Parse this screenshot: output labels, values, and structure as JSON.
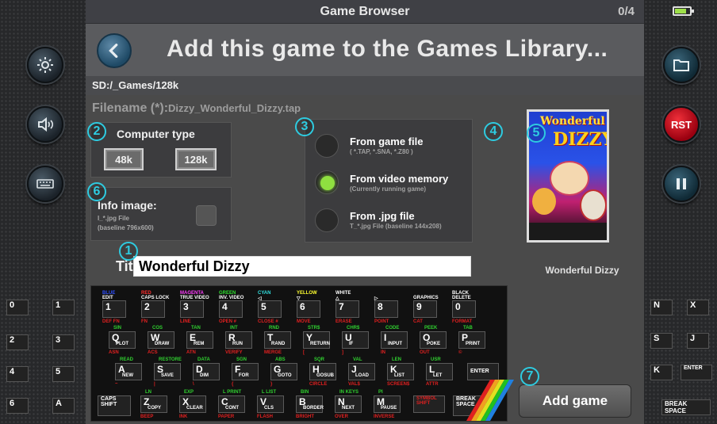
{
  "window": {
    "title": "Game Browser",
    "counter": "0/4"
  },
  "header": {
    "title": "Add this game to the Games Library..."
  },
  "path": "SD:/_Games/128k",
  "filename": {
    "label": "Filename (*):",
    "value": "Dizzy_Wonderful_Dizzy.tap"
  },
  "computer_type": {
    "label": "Computer type",
    "options": [
      "48k",
      "128k"
    ]
  },
  "info_image": {
    "label": "Info image:",
    "line1": "I_*.jpg File",
    "line2": "(baseline 796x600)"
  },
  "sources": [
    {
      "label": "From game file",
      "sub": "( *.TAP, *.SNA, *.Z80 )",
      "selected": false
    },
    {
      "label": "From video memory",
      "sub": "(Currently running game)",
      "selected": true
    },
    {
      "label": "From .jpg file",
      "sub": "T_*.jpg File (baseline 144x208)",
      "selected": false
    }
  ],
  "numbers": [
    "1",
    "2",
    "3",
    "4",
    "5",
    "6",
    "7"
  ],
  "title_field": {
    "label": "Title:",
    "value": "Wonderful Dizzy"
  },
  "cover": {
    "name": "Wonderful Dizzy",
    "art_text": "Wonderful",
    "art_text2": "DIZZY"
  },
  "add_button": "Add game",
  "keyboard": {
    "row1": [
      "1",
      "2",
      "3",
      "4",
      "5",
      "6",
      "7",
      "8",
      "9",
      "0"
    ],
    "row1_top": [
      "EDIT",
      "CAPS LOCK",
      "TRUE VIDEO",
      "INV. VIDEO",
      "◁",
      "▽",
      "△",
      "▷",
      "GRAPHICS",
      "DELETE"
    ],
    "row1_top_colors": [
      "BLUE",
      "RED",
      "MAGENTA",
      "GREEN",
      "CYAN",
      "YELLOW",
      "WHITE",
      "",
      "",
      "BLACK"
    ],
    "row1_bot": [
      "DEF FN",
      "FN",
      "LINE",
      "OPEN #",
      "CLOSE #",
      "MOVE",
      "ERASE",
      "POINT",
      "CAT",
      "FORMAT"
    ],
    "row2": [
      "Q",
      "W",
      "E",
      "R",
      "T",
      "Y",
      "U",
      "I",
      "O",
      "P"
    ],
    "row2_word": [
      "PLOT",
      "DRAW",
      "REM",
      "RUN",
      "RAND",
      "RETURN",
      "IF",
      "INPUT",
      "POKE",
      "PRINT"
    ],
    "row2_top": [
      "SIN",
      "COS",
      "TAN",
      "INT",
      "RND",
      "STR$",
      "CHR$",
      "CODE",
      "PEEK",
      "TAB"
    ],
    "row2_bot": [
      "ASN",
      "ACS",
      "ATN",
      "VERIFY",
      "MERGE",
      "[",
      "]",
      "IN",
      "OUT",
      "©"
    ],
    "row3": [
      "A",
      "S",
      "D",
      "F",
      "G",
      "H",
      "J",
      "K",
      "L"
    ],
    "row3_word": [
      "NEW",
      "SAVE",
      "DIM",
      "FOR",
      "GOTO",
      "GOSUB",
      "LOAD",
      "LIST",
      "LET"
    ],
    "row3_top": [
      "READ",
      "RESTORE",
      "DATA",
      "SGN",
      "ABS",
      "SQR",
      "VAL",
      "LEN",
      "USR"
    ],
    "row3_bot": [
      "~",
      "|",
      "\\",
      "{",
      "}",
      "CIRCLE",
      "VAL$",
      "SCREEN$",
      "ATTR"
    ],
    "enter": "ENTER",
    "row4": [
      "Z",
      "X",
      "C",
      "V",
      "B",
      "N",
      "M"
    ],
    "row4_word": [
      "COPY",
      "CLEAR",
      "CONT",
      "CLS",
      "BORDER",
      "NEXT",
      "PAUSE"
    ],
    "row4_top": [
      "LN",
      "EXP",
      "L PRINT",
      "L LIST",
      "BIN",
      "IN KEYS",
      "PI"
    ],
    "row4_bot": [
      "BEEP",
      "INK",
      "PAPER",
      "FLASH",
      "BRIGHT",
      "OVER",
      "INVERSE"
    ],
    "caps_shift": "CAPS SHIFT",
    "symbol_shift": "SYMBOL SHIFT",
    "break_space": "BREAK SPACE"
  },
  "left_mini_keys": [
    "0",
    "1",
    "2",
    "3",
    "4",
    "5",
    "6",
    "A"
  ],
  "right_mini_keys": [
    "N",
    "X",
    "S",
    "J",
    "K",
    "ENTER",
    "BREAK SPACE"
  ],
  "side_buttons": {
    "rst": "RST"
  }
}
